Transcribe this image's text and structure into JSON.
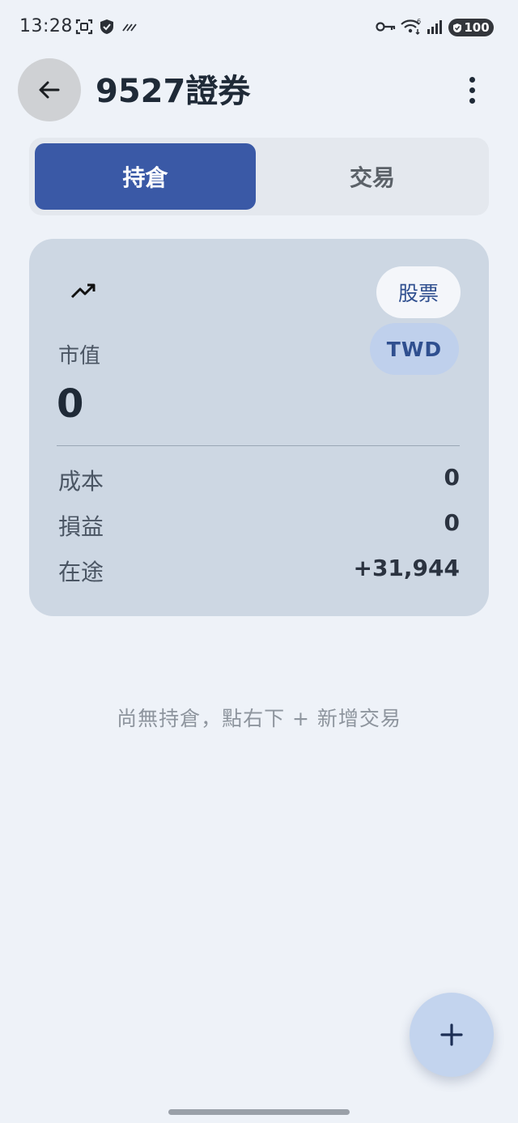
{
  "status_bar": {
    "time": "13:28",
    "battery": "100",
    "icons": [
      "screenshot-icon",
      "shield-icon",
      "signal-muted-icon",
      "key-icon",
      "wifi-icon",
      "cell-signal-icon",
      "battery-icon"
    ]
  },
  "header": {
    "title": "9527證券",
    "icons": [
      "back-arrow-icon",
      "more-vert-icon"
    ]
  },
  "tabs": [
    {
      "label": "持倉",
      "active": true
    },
    {
      "label": "交易",
      "active": false
    }
  ],
  "summary": {
    "icon": "trending-up-icon",
    "chip_type": "股票",
    "chip_currency": "TWD",
    "market_value_label": "市值",
    "market_value": "0",
    "rows": [
      {
        "label": "成本",
        "value": "0"
      },
      {
        "label": "損益",
        "value": "0"
      },
      {
        "label": "在途",
        "value": "+31,944"
      }
    ]
  },
  "empty_state": {
    "message": "尚無持倉，點右下 + 新增交易"
  },
  "fab": {
    "icon": "plus-icon"
  },
  "colors": {
    "background": "#eef2f8",
    "accent": "#3a59a6",
    "card": "#cdd7e3",
    "fab": "#c3d4ee"
  }
}
